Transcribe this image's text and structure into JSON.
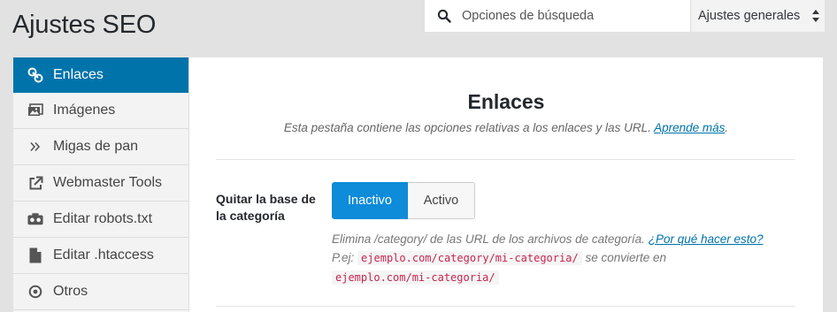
{
  "page": {
    "title": "Ajustes SEO"
  },
  "search": {
    "placeholder": "Opciones de búsqueda"
  },
  "settings_select": {
    "value": "Ajustes generales"
  },
  "sidebar": {
    "items": [
      {
        "label": "Enlaces",
        "icon": "link-icon",
        "active": true
      },
      {
        "label": "Imágenes",
        "icon": "images-icon",
        "active": false
      },
      {
        "label": "Migas de pan",
        "icon": "breadcrumb-chevrons-icon",
        "active": false
      },
      {
        "label": "Webmaster Tools",
        "icon": "external-link-icon",
        "active": false
      },
      {
        "label": "Editar robots.txt",
        "icon": "robot-icon",
        "active": false
      },
      {
        "label": "Editar .htaccess",
        "icon": "file-icon",
        "active": false
      },
      {
        "label": "Otros",
        "icon": "circle-dot-icon",
        "active": false
      }
    ]
  },
  "panel": {
    "title": "Enlaces",
    "intro": "Esta pestaña contiene las opciones relativas a los enlaces y las URL.",
    "intro_link": "Aprende más",
    "intro_end": ".",
    "field": {
      "label": "Quitar la base de la categoría",
      "option_off": "Inactivo",
      "option_on": "Activo",
      "selected": "Inactivo",
      "desc_text": "Elimina /category/ de las URL de los archivos de categoría.",
      "desc_link": "¿Por qué hacer esto?",
      "example_prefix": "P.ej:",
      "example_from": "ejemplo.com/category/mi-categoria/",
      "example_middle": "se convierte en",
      "example_to": "ejemplo.com/mi-categoria/"
    }
  },
  "colors": {
    "accent": "#0073aa",
    "toggle_active": "#0e8bd9",
    "code_text": "#c7254e"
  }
}
